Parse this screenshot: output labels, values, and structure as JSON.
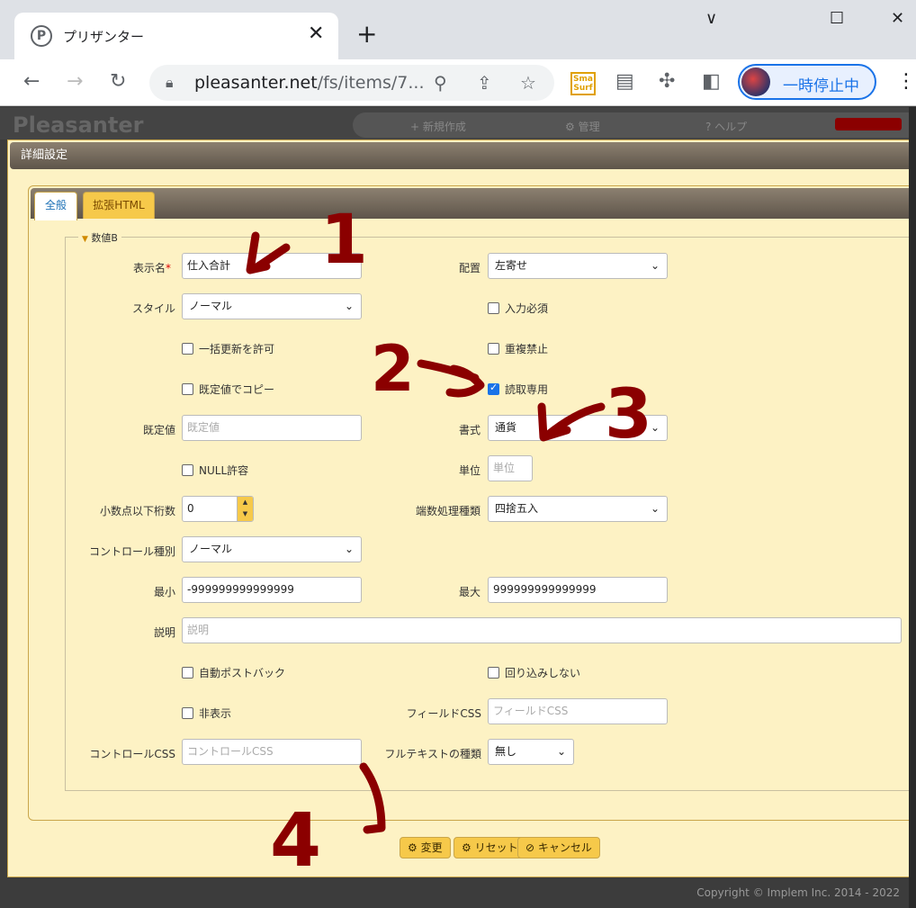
{
  "browser": {
    "tab_favicon": "P",
    "tab_title": "プリザンター",
    "tab_close_icon": "✕",
    "new_tab_icon": "+",
    "url_host": "pleasanter.net",
    "url_path": "/fs/items/7...",
    "profile_label": "一時停止中",
    "window_minimize": "∨",
    "window_restore": "☐",
    "window_close": "✕"
  },
  "site": {
    "logo": "Pleasanter",
    "nav": [
      "+ 新規作成",
      "⚙ 管理",
      "? ヘルプ"
    ]
  },
  "dialog": {
    "title": "詳細設定",
    "tabs": [
      "全般",
      "拡張HTML"
    ],
    "legend": "数値B"
  },
  "form": {
    "display_name_label": "表示名",
    "display_name_req": "*",
    "display_name_value": "仕入合計",
    "align_label": "配置",
    "align_value": "左寄せ",
    "style_label": "スタイル",
    "style_value": "ノーマル",
    "required_label": "入力必須",
    "bulk_update_label": "一括更新を許可",
    "no_duplicate_label": "重複禁止",
    "copy_default_label": "既定値でコピー",
    "readonly_label": "読取専用",
    "default_label": "既定値",
    "default_placeholder": "既定値",
    "format_label": "書式",
    "format_value": "通貨",
    "null_label": "NULL許容",
    "unit_label": "単位",
    "unit_placeholder": "単位",
    "decimals_label": "小数点以下桁数",
    "decimals_value": "0",
    "rounding_label": "端数処理種類",
    "rounding_value": "四捨五入",
    "control_type_label": "コントロール種別",
    "control_type_value": "ノーマル",
    "min_label": "最小",
    "min_value": "-999999999999999",
    "max_label": "最大",
    "max_value": "999999999999999",
    "desc_label": "説明",
    "desc_placeholder": "説明",
    "autopostback_label": "自動ポストバック",
    "nowrap_label": "回り込みしない",
    "hidden_label": "非表示",
    "field_css_label": "フィールドCSS",
    "field_css_placeholder": "フィールドCSS",
    "control_css_label": "コントロールCSS",
    "control_css_placeholder": "コントロールCSS",
    "fulltext_label": "フルテキストの種類",
    "fulltext_value": "無し"
  },
  "buttons": {
    "change": "変更",
    "reset": "リセット",
    "cancel": "キャンセル"
  },
  "footer": "Copyright © Implem Inc. 2014 - 2022",
  "annotations": [
    "1",
    "2",
    "3",
    "4"
  ],
  "colors": {
    "accent": "#f6c94a",
    "panel": "#fdf2c4",
    "annotation": "#8b0000",
    "link": "#1a73e8"
  }
}
